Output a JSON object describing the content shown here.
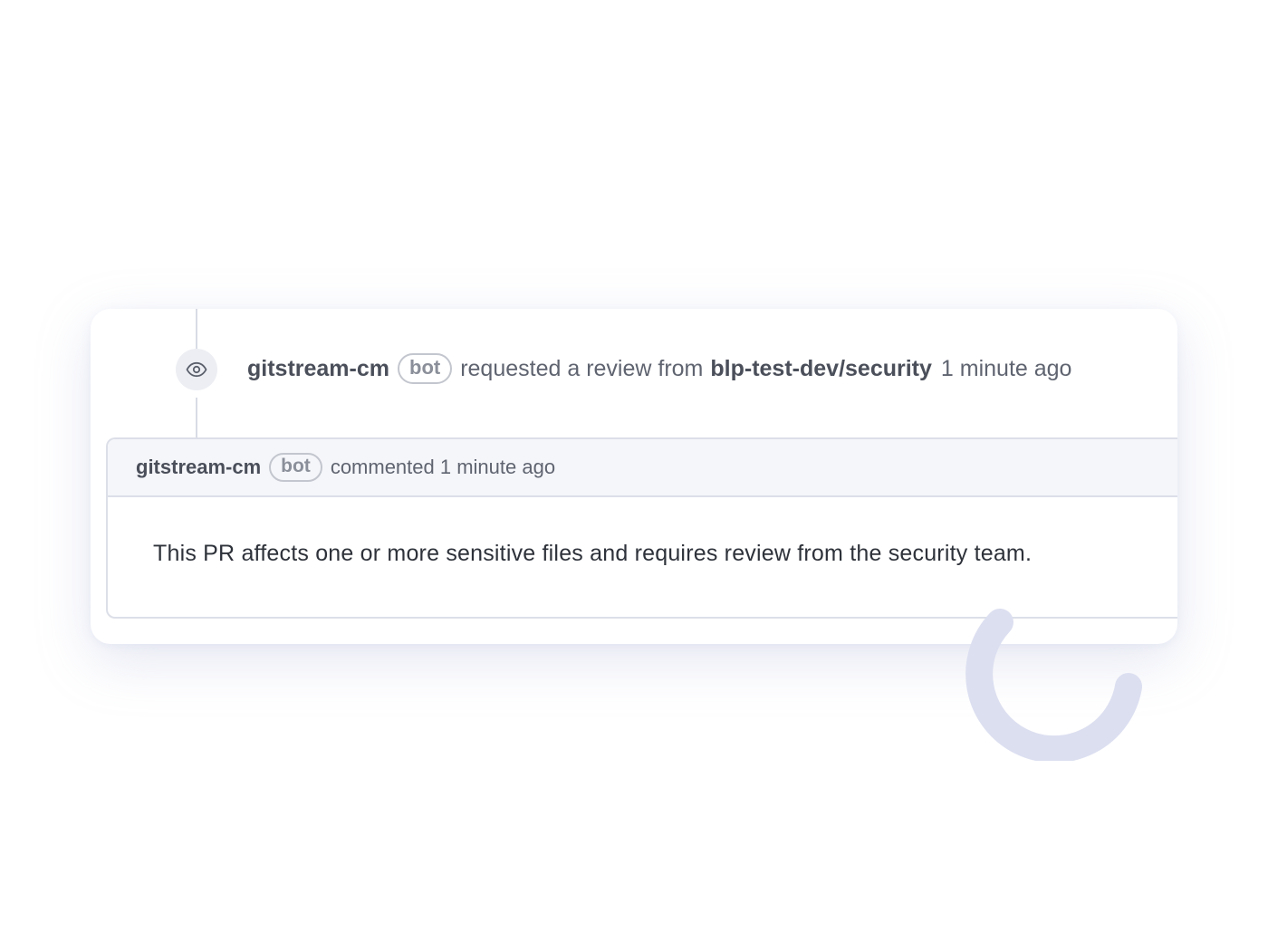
{
  "review_event": {
    "icon": "eye-icon",
    "actor": "gitstream-cm",
    "badge": "bot",
    "action_text": "requested a review from",
    "team": "blp-test-dev/security",
    "timestamp": "1 minute ago"
  },
  "comment": {
    "author": "gitstream-cm",
    "badge": "bot",
    "meta": "commented 1 minute ago",
    "body": "This PR affects one or more sensitive files and requires review from the security team."
  },
  "colors": {
    "accent_arc": "#dcdff0",
    "timeline": "#d8dbe4",
    "header_bg": "#f5f6fa"
  }
}
